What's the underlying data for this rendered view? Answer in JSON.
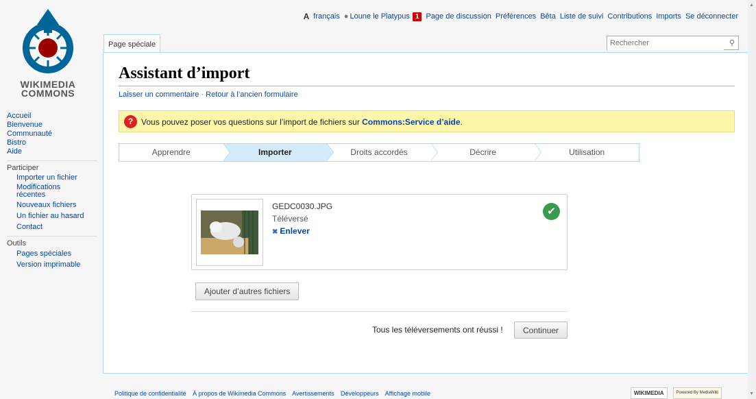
{
  "logo": {
    "line1": "WIKIMEDIA",
    "line2": "COMMONS"
  },
  "personal": {
    "language": "français",
    "username": "Loune le Platypus",
    "notifications": "1",
    "links": [
      "Page de discussion",
      "Préférences",
      "Bêta",
      "Liste de suivi",
      "Contributions",
      "Imports",
      "Se déconnecter"
    ]
  },
  "tabs": {
    "special_page": "Page spéciale"
  },
  "search": {
    "placeholder": "Rechercher"
  },
  "page": {
    "title": "Assistant d’import",
    "subtitle_link1": "Laisser un commentaire",
    "subtitle_sep": " · ",
    "subtitle_link2": "Retour à l’ancien formulaire"
  },
  "notice": {
    "text": "Vous pouvez poser vos questions sur l’import de fichiers sur ",
    "link": "Commons:Service d’aide",
    "end": "."
  },
  "steps": [
    {
      "label": "Apprendre"
    },
    {
      "label": "Importer"
    },
    {
      "label": "Droits accordés"
    },
    {
      "label": "Décrire"
    },
    {
      "label": "Utilisation"
    }
  ],
  "file": {
    "name": "GEDC0030.JPG",
    "status": "Téléversé",
    "remove_label": "Enlever"
  },
  "buttons": {
    "add_more": "Ajouter d’autres fichiers",
    "continue": "Continuer"
  },
  "result": {
    "message": "Tous les téléversements ont réussi !"
  },
  "sidebar": {
    "nav": [
      "Accueil",
      "Bienvenue",
      "Communauté",
      "Bistro",
      "Aide"
    ],
    "participate_heading": "Participer",
    "participate": [
      "Importer un fichier",
      "Modifications récentes",
      "Nouveaux fichiers",
      "Un fichier au hasard",
      "Contact"
    ],
    "tools_heading": "Outils",
    "tools": [
      "Pages spéciales",
      "Version imprimable"
    ]
  },
  "footer": {
    "links": [
      "Politique de confidentialité",
      "À propos de Wikimedia Commons",
      "Avertissements",
      "Développeurs",
      "Affichage mobile"
    ],
    "badge1": "WIKIMEDIA",
    "badge2": "Powered By MediaWiki"
  },
  "colors": {
    "link": "#0645ad",
    "notice_bg": "#fef6a8",
    "step_active": "#d6ebfa",
    "border_blue": "#a7d7f9",
    "success": "#3a9b4f"
  }
}
